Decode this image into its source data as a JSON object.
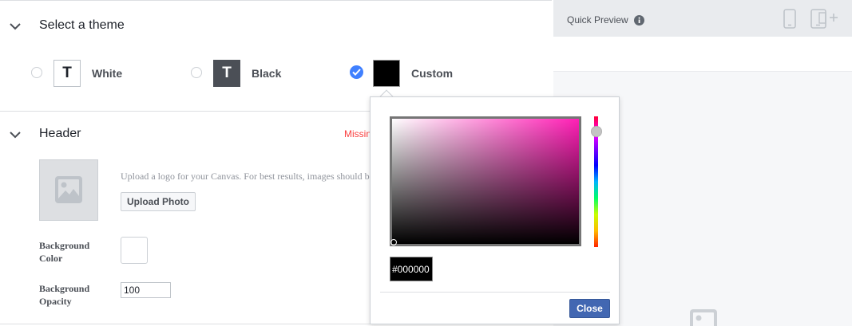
{
  "theme_section": {
    "title": "Select a theme",
    "options": [
      {
        "label": "White",
        "swatch_text": "T",
        "selected": false
      },
      {
        "label": "Black",
        "swatch_text": "T",
        "selected": false
      },
      {
        "label": "Custom",
        "swatch_text": "",
        "selected": true
      }
    ]
  },
  "header_section": {
    "title": "Header",
    "warning": "Missing",
    "upload_description": "Upload a logo for your Canvas. For best results, images should be",
    "upload_button": "Upload Photo",
    "background_color_label": "Background Color",
    "background_color_value": "#ffffff",
    "background_opacity_label": "Background Opacity",
    "background_opacity_value": "100"
  },
  "preview": {
    "title": "Quick Preview",
    "icons": [
      "info-icon",
      "phone-icon",
      "tablet-add-icon",
      "image-icon"
    ]
  },
  "color_picker": {
    "hex_value": "#000000",
    "hue_color": "#ff1fb5",
    "close_button": "Close"
  },
  "colors": {
    "accent": "#4267b2",
    "radio_checked": "#4080ff",
    "warning": "#fa3e3e"
  }
}
